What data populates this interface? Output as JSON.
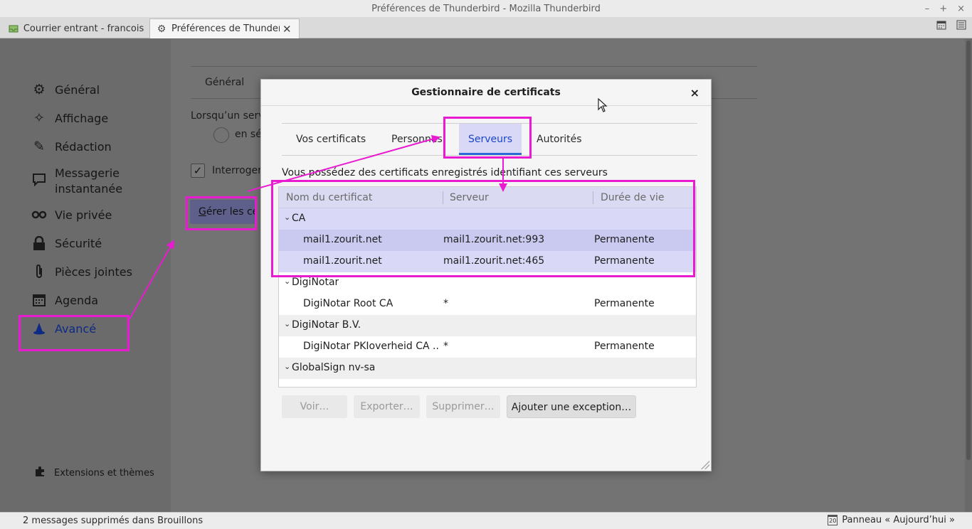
{
  "window": {
    "title": "Préférences de Thunderbird - Mozilla Thunderbird",
    "controls": [
      "–",
      "+",
      "×"
    ]
  },
  "tabs": [
    {
      "label": "Courrier entrant - francois@",
      "icon": "inbox-icon"
    },
    {
      "label": "Préférences de Thunderbird",
      "icon": "gear-icon",
      "close": "✕"
    }
  ],
  "sidebar": {
    "items": [
      {
        "label": "Général",
        "icon": "gear-icon"
      },
      {
        "label": "Affichage",
        "icon": "display-icon"
      },
      {
        "label": "Rédaction",
        "icon": "pencil-icon"
      },
      {
        "label": "Messagerie\ninstantanée",
        "icon": "chat-icon"
      },
      {
        "label": "Vie privée",
        "icon": "mask-icon"
      },
      {
        "label": "Sécurité",
        "icon": "lock-icon"
      },
      {
        "label": "Pièces jointes",
        "icon": "paperclip-icon"
      },
      {
        "label": "Agenda",
        "icon": "calendar-icon"
      },
      {
        "label": "Avancé",
        "icon": "wizard-hat-icon",
        "selected": true
      }
    ],
    "extensions_label": "Extensions et thèmes"
  },
  "pane": {
    "tab_label": "Général",
    "text": "Lorsqu’un serv",
    "radio_label": "en sé",
    "checkbox_label": "Interroger",
    "manage_button_prefix": "G",
    "manage_button_rest": "érer les cer"
  },
  "dialog": {
    "title": "Gestionnaire de certificats",
    "close": "×",
    "tabs": [
      "Vos certificats",
      "Personnes",
      "Serveurs",
      "Autorités"
    ],
    "active_tab": "Serveurs",
    "description": "Vous possédez des certificats enregistrés identifiant ces serveurs",
    "columns": [
      "Nom du certificat",
      "Serveur",
      "Durée de vie"
    ],
    "rows": [
      {
        "type": "group",
        "name": "CA"
      },
      {
        "type": "item",
        "name": "mail1.zourit.net",
        "server": "mail1.zourit.net:993",
        "lifetime": "Permanente"
      },
      {
        "type": "item",
        "name": "mail1.zourit.net",
        "server": "mail1.zourit.net:465",
        "lifetime": "Permanente"
      },
      {
        "type": "group",
        "name": "DigiNotar"
      },
      {
        "type": "item",
        "name": "DigiNotar Root CA",
        "server": "*",
        "lifetime": "Permanente"
      },
      {
        "type": "group",
        "name": "DigiNotar B.V."
      },
      {
        "type": "item",
        "name": "DigiNotar PKIoverheid CA ...",
        "server": "*",
        "lifetime": "Permanente"
      },
      {
        "type": "group",
        "name": "GlobalSign nv-sa"
      }
    ],
    "buttons": {
      "view": "Voir…",
      "export": "Exporter…",
      "delete": "Supprimer…",
      "add_exception_accesskey": "j",
      "add_exception_prefix": "A",
      "add_exception_rest": "outer une exception…"
    }
  },
  "statusbar": {
    "left": "2 messages supprimés dans Brouillons",
    "right": "Panneau « Aujourd’hui »",
    "calendar_day": "20"
  },
  "colors": {
    "annotation": "#e91bd0",
    "selected_text": "#0d2a86",
    "active_tab_text": "#1a46c7"
  }
}
